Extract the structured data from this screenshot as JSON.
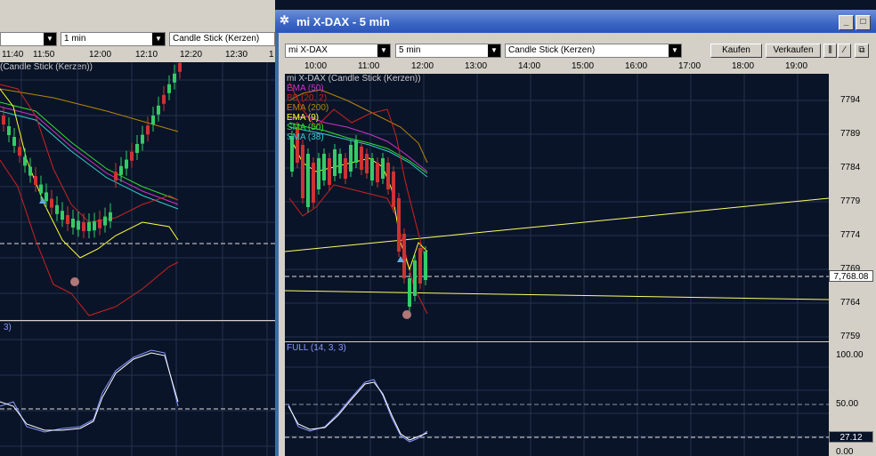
{
  "left_window": {
    "toolbar": {
      "interval": "1 min",
      "chart_type": "Candle Stick (Kerzen)"
    },
    "time_labels": [
      "11:40",
      "11:50",
      "12:00",
      "12:10",
      "12:20",
      "12:30",
      "1"
    ],
    "chart_header": "(Candle Stick (Kerzen))",
    "osc_label": "3)"
  },
  "right_window": {
    "title": "mi X-DAX - 5 min",
    "toolbar": {
      "instrument": "mi X-DAX",
      "interval": "5 min",
      "chart_type": "Candle Stick (Kerzen)",
      "buy_label": "Kaufen",
      "sell_label": "Verkaufen"
    },
    "time_labels": [
      "10:00",
      "11:00",
      "12:00",
      "13:00",
      "14:00",
      "15:00",
      "16:00",
      "17:00",
      "18:00",
      "19:00"
    ],
    "chart_header": "mi X-DAX (Candle Stick (Kerzen))",
    "legend": [
      {
        "text": "EMA (50)",
        "color": "#cc33cc"
      },
      {
        "text": "BB (20, 2)",
        "color": "#cc2222"
      },
      {
        "text": "EMA (200)",
        "color": "#b8860b"
      },
      {
        "text": "EMA (9)",
        "color": "#ffff33"
      },
      {
        "text": "SMA (50)",
        "color": "#33dd33"
      },
      {
        "text": "SMA (38)",
        "color": "#33cccc"
      }
    ],
    "price_axis": [
      "7794",
      "7789",
      "7784",
      "7779",
      "7774",
      "7769",
      "7764",
      "7759"
    ],
    "last_price": "7,768.08",
    "oscillator": {
      "label": "FULL (14, 3, 3)",
      "axis": [
        "100.00",
        "50.00",
        "0.00"
      ],
      "current": "27.12"
    }
  },
  "colors": {
    "chart_bg": "#0a1428",
    "grid": "#23324e",
    "accent_title": "#3b65c4"
  }
}
